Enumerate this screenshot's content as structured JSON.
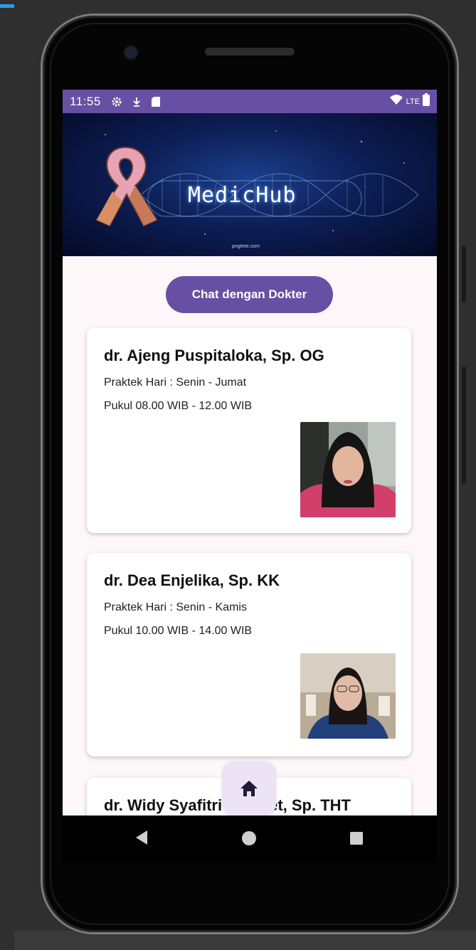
{
  "status_bar": {
    "time": "11:55",
    "network": "LTE",
    "icons": [
      "gear-icon",
      "download-icon",
      "sd-card-icon",
      "wifi-icon",
      "battery-icon"
    ],
    "color": "#6750a4"
  },
  "banner": {
    "title": "MedicHub",
    "source": "pngtree.com",
    "logo": "awareness-ribbon-icon"
  },
  "chat_button": {
    "label": "Chat dengan Dokter",
    "color": "#6750a4"
  },
  "doctors": [
    {
      "name": "dr. Ajeng Puspitaloka, Sp. OG",
      "days": "Praktek Hari : Senin - Jumat",
      "hours": "Pukul 08.00 WIB - 12.00 WIB"
    },
    {
      "name": "dr. Dea Enjelika, Sp. KK",
      "days": "Praktek Hari : Senin - Kamis",
      "hours": "Pukul 10.00 WIB - 14.00 WIB"
    },
    {
      "name_start": "dr. Widy Syafitri",
      "name_end": "et, Sp. THT"
    }
  ],
  "fab": {
    "icon": "home-icon",
    "color": "#ece4f6"
  },
  "nav_bar": {
    "icons": [
      "back-icon",
      "home-circle-icon",
      "recent-apps-icon"
    ]
  }
}
